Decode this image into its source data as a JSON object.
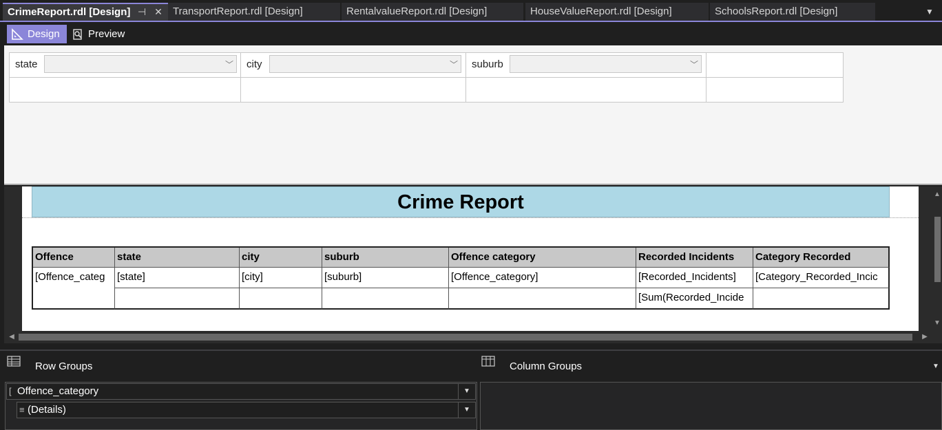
{
  "tabs": [
    {
      "label": "CrimeReport.rdl [Design]",
      "active": true
    },
    {
      "label": "TransportReport.rdl [Design]",
      "active": false
    },
    {
      "label": "RentalvalueReport.rdl [Design]",
      "active": false
    },
    {
      "label": "HouseValueReport.rdl [Design]",
      "active": false
    },
    {
      "label": "SchoolsReport.rdl [Design]",
      "active": false
    }
  ],
  "tab_controls": {
    "pin": "⊣",
    "close": "✕",
    "overflow": "▼"
  },
  "view_toolbar": {
    "design_label": "Design",
    "preview_label": "Preview",
    "design_icon": "ruler-triangle-icon",
    "preview_icon": "magnifier-page-icon"
  },
  "parameters": [
    {
      "label": "state",
      "value": ""
    },
    {
      "label": "city",
      "value": ""
    },
    {
      "label": "suburb",
      "value": ""
    }
  ],
  "report": {
    "title": "Crime Report",
    "table": {
      "headers": [
        "Offence",
        "state",
        "city",
        "suburb",
        "Offence category",
        "Recorded Incidents",
        "Category Recorded"
      ],
      "detail_row": [
        "[Offence_categ",
        "[state]",
        "[city]",
        "[suburb]",
        "[Offence_category]",
        "[Recorded_Incidents]",
        "[Category_Recorded_Incic"
      ],
      "total_row": [
        "",
        "",
        "",
        "",
        "",
        "[Sum(Recorded_Incide",
        ""
      ]
    }
  },
  "grouping": {
    "row_groups_title": "Row Groups",
    "column_groups_title": "Column Groups",
    "row_groups": [
      "Offence_category",
      "(Details)"
    ],
    "dropdown_glyph": "▼",
    "pane_menu_glyph": "▼"
  },
  "colors": {
    "accent": "#8b86d9",
    "title_bg": "#add8e6",
    "header_bg": "#c8c8c8",
    "param_bg": "#f5f5f5"
  }
}
